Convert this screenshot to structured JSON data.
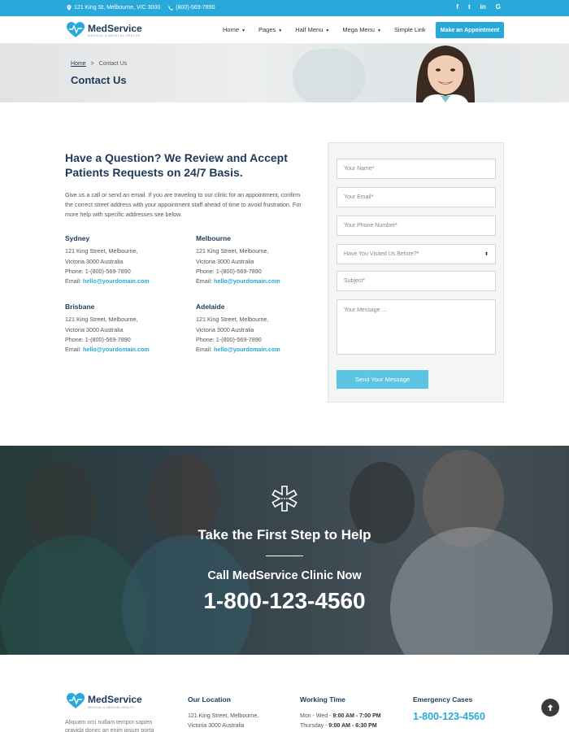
{
  "topbar": {
    "address": "121 King St, Melbourne, VIC 3000",
    "phone": "(800)-569-7890",
    "social": [
      "f",
      "t",
      "in",
      "G"
    ]
  },
  "brand": {
    "name": "MedService",
    "tagline": "MEDICAL & MEDICAL HEALTH"
  },
  "nav": {
    "items": [
      "Home",
      "Pages",
      "Half Menu",
      "Mega Menu",
      "Simple Link"
    ],
    "cta": "Make an Appointment"
  },
  "page": {
    "breadcrumb_home": "Home",
    "breadcrumb_sep": ">",
    "breadcrumb_current": "Contact Us",
    "title": "Contact Us"
  },
  "contact": {
    "heading": "Have a Question? We Review and Accept Patients Requests on 24/7 Basis.",
    "intro": "Give us a call or send an email. If you are traveling to our clinic for an appointment, confirm the correct street address with your appointment staff ahead of time to avoid frustration. For more help with specific addresses see below.",
    "offices": [
      {
        "name": "Sydney",
        "street": "121 King Street, Melbourne,",
        "city": "Victoria 3000 Australia",
        "phone": "Phone: 1-(800)-569-7890",
        "email_label": "Email:",
        "email": "hello@yourdomain.com"
      },
      {
        "name": "Melbourne",
        "street": "121 King Street, Melbourne,",
        "city": "Victoria 3000 Australia",
        "phone": "Phone: 1-(800)-569-7890",
        "email_label": "Email:",
        "email": "hello@yourdomain.com"
      },
      {
        "name": "Brisbane",
        "street": "121 King Street, Melbourne,",
        "city": "Victoria 3000 Australia",
        "phone": "Phone: 1-(800)-569-7890",
        "email_label": "Email:",
        "email": "hello@yourdomain.com"
      },
      {
        "name": "Adelaide",
        "street": "121 King Street, Melbourne,",
        "city": "Victoria 3000 Australia",
        "phone": "Phone: 1-(800)-569-7890",
        "email_label": "Email:",
        "email": "hello@yourdomain.com"
      }
    ]
  },
  "form": {
    "name_placeholder": "Your Name*",
    "email_placeholder": "Your Email*",
    "phone_placeholder": "Your Phone Number*",
    "visited_select": "Have You Visited Us Before?*",
    "subject_placeholder": "Subject*",
    "message_placeholder": "Your Message ...",
    "submit": "Send Your Message"
  },
  "banner": {
    "title": "Take the First Step to Help",
    "subtitle": "Call MedService Clinic Now",
    "phone": "1-800-123-4560"
  },
  "footer": {
    "desc": "Aliquam orci nullam tempor sapien gravida donec an enim ipsum porta",
    "location": {
      "heading": "Our Location",
      "line1": "121 King Street, Melbourne,",
      "line2": "Victoria 3000 Australia"
    },
    "hours": {
      "heading": "Working Time",
      "row1_label": "Mon - Wed -",
      "row1_time": "9:00 AM - 7:00 PM",
      "row2_label": "Thursday -",
      "row2_time": "9:00 AM - 6:30 PM"
    },
    "emergency": {
      "heading": "Emergency Cases",
      "phone": "1-800-123-4560"
    }
  },
  "colors": {
    "accent": "#29a9d9",
    "navy": "#1e3a5a",
    "button_light": "#5bc5e3"
  }
}
